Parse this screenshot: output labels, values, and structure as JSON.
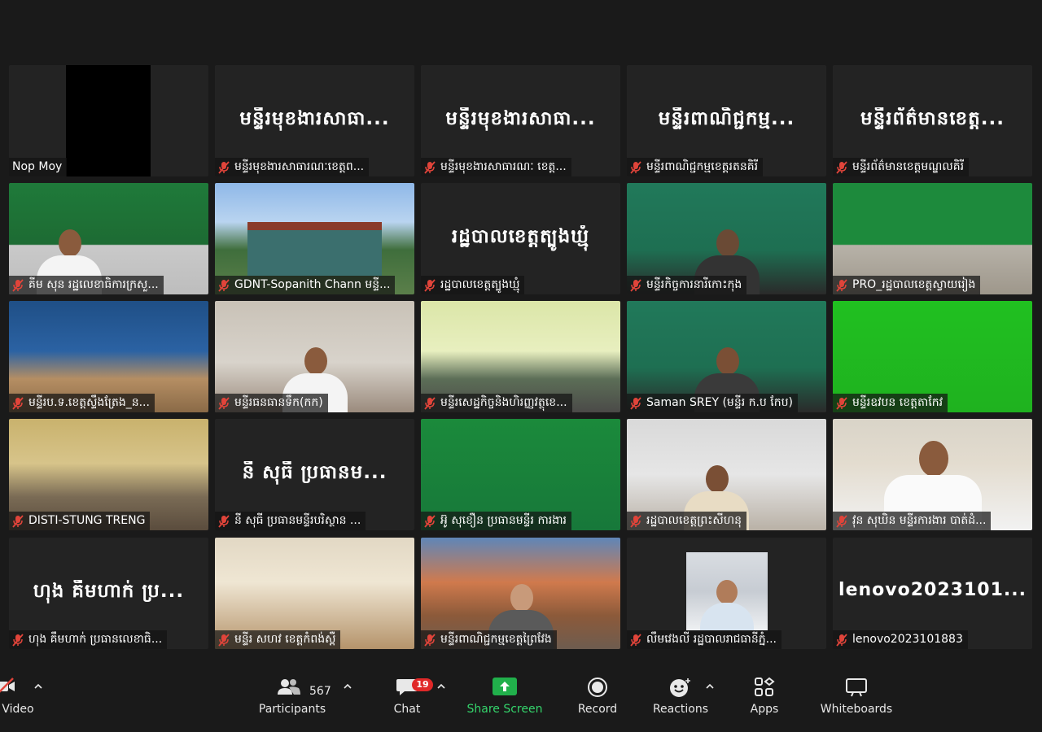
{
  "tiles": [
    {
      "id": "t1",
      "big": "",
      "label": "Nop Moy",
      "muted": false
    },
    {
      "id": "t2",
      "big": "មន្ទីរមុខងារសាធា...",
      "label": "មន្ទីរមុខងារសាធារណៈខេត្តព...",
      "muted": true
    },
    {
      "id": "t3",
      "big": "មន្ទីរមុខងារសាធា...",
      "label": "មន្ទីរមុខងារសាធារណៈ ខេត្ត...",
      "muted": true
    },
    {
      "id": "t4",
      "big": "មន្ទីរពាណិជ្ជកម្ម...",
      "label": "មន្ទីរពាណិជ្ជកម្មខេត្តរតនគិរី",
      "muted": true
    },
    {
      "id": "t5",
      "big": "មន្ទីរព័ត៌មានខេត្ត...",
      "label": "មន្ទីរព័ត៌មានខេត្តមណ្ឌលគិរី",
      "muted": true
    },
    {
      "id": "t6",
      "big": "",
      "label": "គីម សុន រដ្ឋលេខាធិការក្រសួ...",
      "muted": true
    },
    {
      "id": "t7",
      "big": "",
      "label": "GDNT-Sopanith Chann មន្ទី...",
      "muted": true
    },
    {
      "id": "t8",
      "big": "រដ្ឋបាលខេត្តត្បូងឃ្មុំ",
      "label": "រដ្ឋបាលខេត្តត្បូងឃ្មុំ",
      "muted": true
    },
    {
      "id": "t9",
      "big": "",
      "label": "មន្ទីរកិច្ចការនារីកោះកុង",
      "muted": true
    },
    {
      "id": "t10",
      "big": "",
      "label": "PRO_រដ្ឋបាលខេត្តស្វាយរៀង",
      "muted": true
    },
    {
      "id": "t11",
      "big": "",
      "label": "មន្ទីរប.ទ.ខេត្តស្ទឹងត្រែង_ន...",
      "muted": true
    },
    {
      "id": "t12",
      "big": "",
      "label": "មន្ទីរធនធានទឹក(កក)",
      "muted": true
    },
    {
      "id": "t13",
      "big": "",
      "label": "មន្ទីរសេដ្ឋកិច្ចនិងហិរញ្ញវត្ថុខេ...",
      "muted": true
    },
    {
      "id": "t14",
      "big": "",
      "label": "Saman SREY (មន្ទីរ ក.ប កែប)",
      "muted": true
    },
    {
      "id": "t15",
      "big": "",
      "label": "មន្ទីរឧវបន ខេត្តតាកែវ",
      "muted": true
    },
    {
      "id": "t16",
      "big": "",
      "label": "DISTI-STUNG TRENG",
      "muted": true
    },
    {
      "id": "t17",
      "big": "នី សុធី ប្រធានម...",
      "label": "នី សុធី ប្រធានមន្ទីរបរិស្ថាន ...",
      "muted": true
    },
    {
      "id": "t18",
      "big": "",
      "label": "អ៊ូ សុខឿន ប្រធានមន្ទីរ ការងារ",
      "muted": true
    },
    {
      "id": "t19",
      "big": "",
      "label": "រដ្ឋបាលខេត្តព្រះសីហនុ",
      "muted": true
    },
    {
      "id": "t20",
      "big": "",
      "label": "វុន សុឃិន មន្ទីរការងារ បាត់ដំ...",
      "muted": true
    },
    {
      "id": "t21",
      "big": "ហុង គឹមហាក់ ប្រ...",
      "label": "ហុង គឹមហាក់ ប្រធានលេខាធិ...",
      "muted": true
    },
    {
      "id": "t22",
      "big": "",
      "label": "មន្ទីរ សហវ ខេត្តកំពង់ស្ពឺ",
      "muted": true
    },
    {
      "id": "t23",
      "big": "",
      "label": "មន្ទីរពាណិជ្ជកម្មខេត្តព្រៃវែង",
      "muted": true
    },
    {
      "id": "t24",
      "big": "",
      "label": "លឹមវេងលី រដ្ឋបាលរាជធានីភ្នំ...",
      "muted": true
    },
    {
      "id": "t25",
      "big": "lenovo2023101...",
      "label": "lenovo2023101883",
      "muted": true
    }
  ],
  "toolbar": {
    "video_label": "Video",
    "participants_label": "Participants",
    "participants_count": "567",
    "chat_label": "Chat",
    "chat_badge": "19",
    "share_label": "Share Screen",
    "record_label": "Record",
    "reactions_label": "Reactions",
    "apps_label": "Apps",
    "whiteboards_label": "Whiteboards"
  },
  "colors": {
    "share_green": "#34d46b",
    "badge_red": "#e02828",
    "mic_red": "#e0443a"
  }
}
